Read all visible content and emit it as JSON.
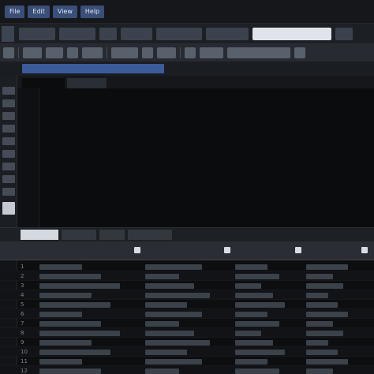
{
  "menubar": {
    "items": [
      "File",
      "Edit",
      "View",
      "Help"
    ]
  },
  "tabs": [
    "",
    "",
    "",
    "",
    "",
    "",
    "",
    ""
  ],
  "toolbar": {
    "buttons": [
      "",
      "",
      "",
      "",
      "",
      "",
      "",
      "",
      "",
      "",
      "",
      ""
    ]
  },
  "active_file": "",
  "doc_tabs": [
    "",
    ""
  ],
  "code_lines": [
    [
      {
        "t": "comment",
        "v": ""
      }
    ],
    [
      {
        "t": "kw",
        "v": ""
      },
      {
        "t": "id",
        "v": ""
      }
    ],
    [
      {
        "t": "kw",
        "v": ""
      },
      {
        "t": "id",
        "v": ""
      },
      {
        "t": "kw",
        "v": ""
      },
      {
        "t": "id",
        "v": ""
      },
      {
        "t": "kw",
        "v": ""
      },
      {
        "t": "id",
        "v": ""
      }
    ],
    [
      {
        "t": "kw",
        "v": ""
      },
      {
        "t": "id",
        "v": ""
      }
    ],
    [
      {
        "t": "plain",
        "v": ""
      }
    ],
    [
      {
        "t": "comment",
        "v": ""
      }
    ],
    [
      {
        "t": "kw",
        "v": ""
      },
      {
        "t": "id",
        "v": ""
      }
    ],
    [
      {
        "t": "kw",
        "v": ""
      },
      {
        "t": "id",
        "v": ""
      },
      {
        "t": "kw",
        "v": ""
      },
      {
        "t": "id",
        "v": ""
      },
      {
        "t": "kw",
        "v": ""
      },
      {
        "t": "id",
        "v": ""
      }
    ],
    [
      {
        "t": "kw",
        "v": ""
      },
      {
        "t": "id",
        "v": ""
      },
      {
        "t": "kw",
        "v": ""
      },
      {
        "t": "id",
        "v": ""
      }
    ],
    [
      {
        "t": "kw",
        "v": ""
      }
    ],
    [
      {
        "t": "kw",
        "v": ""
      },
      {
        "t": "id",
        "v": ""
      }
    ],
    [
      {
        "t": "plain",
        "v": ""
      }
    ],
    [
      {
        "t": "kw",
        "v": ""
      },
      {
        "t": "id",
        "v": ""
      }
    ]
  ],
  "results_tabs": [
    "",
    "",
    "",
    ""
  ],
  "grid": {
    "headers": [
      {
        "title": "",
        "sub": ""
      },
      {
        "title": "",
        "sub": ""
      },
      {
        "title": "",
        "sub": ""
      },
      {
        "title": "",
        "sub": ""
      }
    ],
    "row_numbers": [
      "1",
      "2",
      "3",
      "4",
      "5",
      "6",
      "7",
      "8",
      "9",
      "10",
      "11",
      "12"
    ]
  },
  "colors": {
    "comment": "#3fbf4a",
    "keyword": "#e0554f",
    "identifier": "#4a8fd6",
    "accent": "#3b5b9a"
  }
}
